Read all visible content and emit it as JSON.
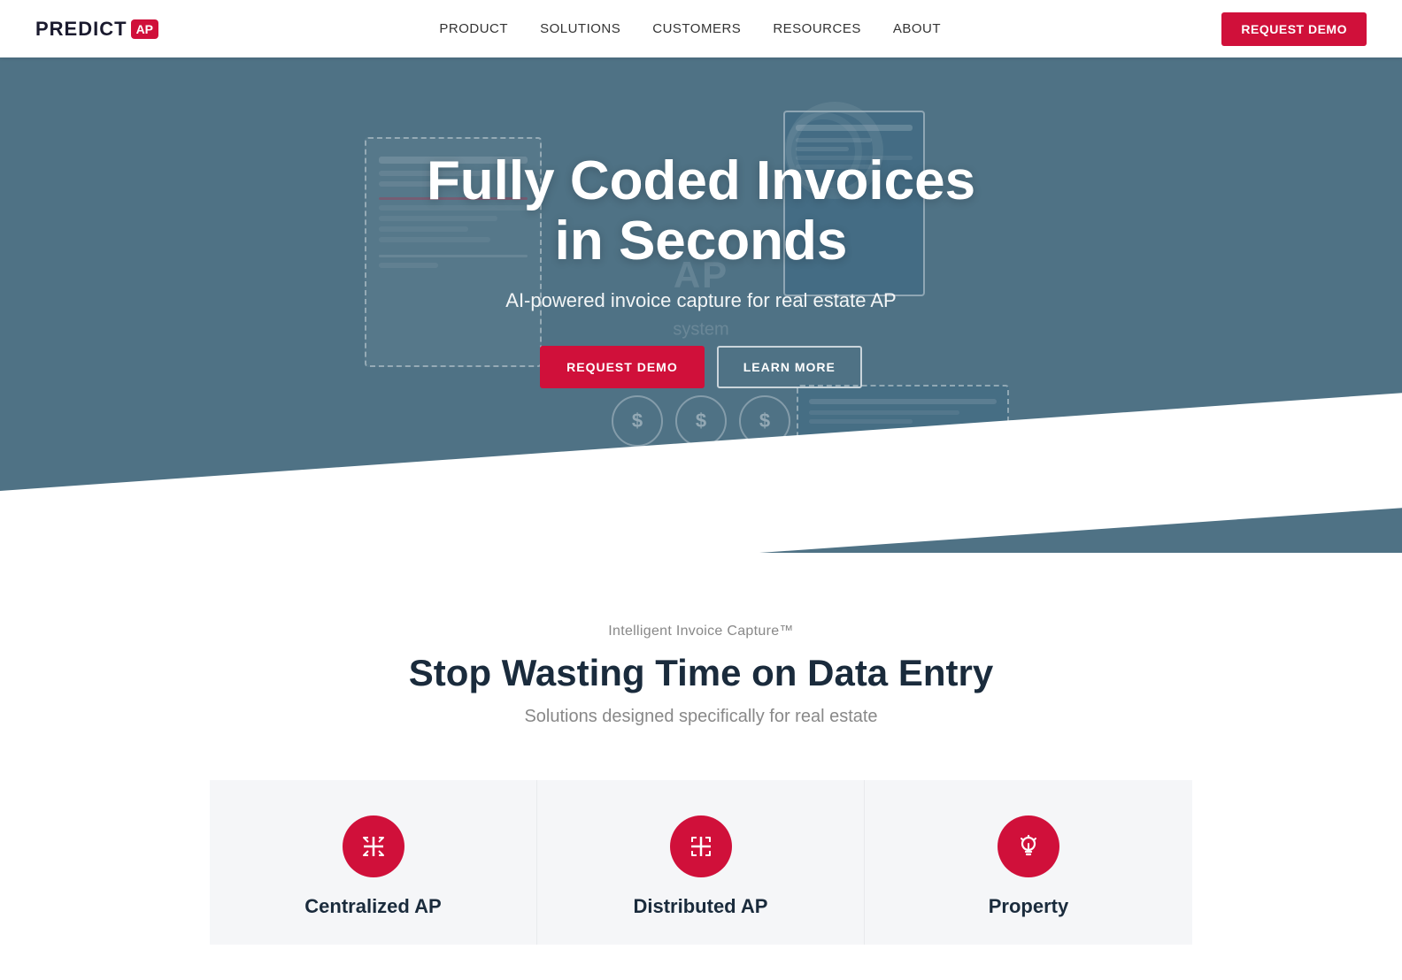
{
  "navbar": {
    "logo_text": "PREDICT",
    "logo_badge": "AP",
    "nav_links": [
      {
        "label": "PRODUCT",
        "href": "#"
      },
      {
        "label": "SOLUTIONS",
        "href": "#"
      },
      {
        "label": "CUSTOMERS",
        "href": "#"
      },
      {
        "label": "RESOURCES",
        "href": "#"
      },
      {
        "label": "ABOUT",
        "href": "#"
      }
    ],
    "cta_label": "REQUEST DEMO"
  },
  "hero": {
    "title_line1": "Fully Coded Invoices",
    "title_line2": "in Seconds",
    "subtitle": "AI-powered invoice capture for real estate AP",
    "btn_demo": "REQUEST DEMO",
    "btn_learn": "LEARN MORE",
    "ap_text": "AP",
    "system_text": "system",
    "dollar_symbol": "$"
  },
  "middle_section": {
    "label": "Intelligent Invoice Capture™",
    "title": "Stop Wasting Time on Data Entry",
    "description": "Solutions designed specifically for real estate"
  },
  "cards": [
    {
      "icon": "⊕",
      "title": "Centralized AP"
    },
    {
      "icon": "⤢",
      "title": "Distributed AP"
    },
    {
      "icon": "💡",
      "title": "Property"
    }
  ]
}
